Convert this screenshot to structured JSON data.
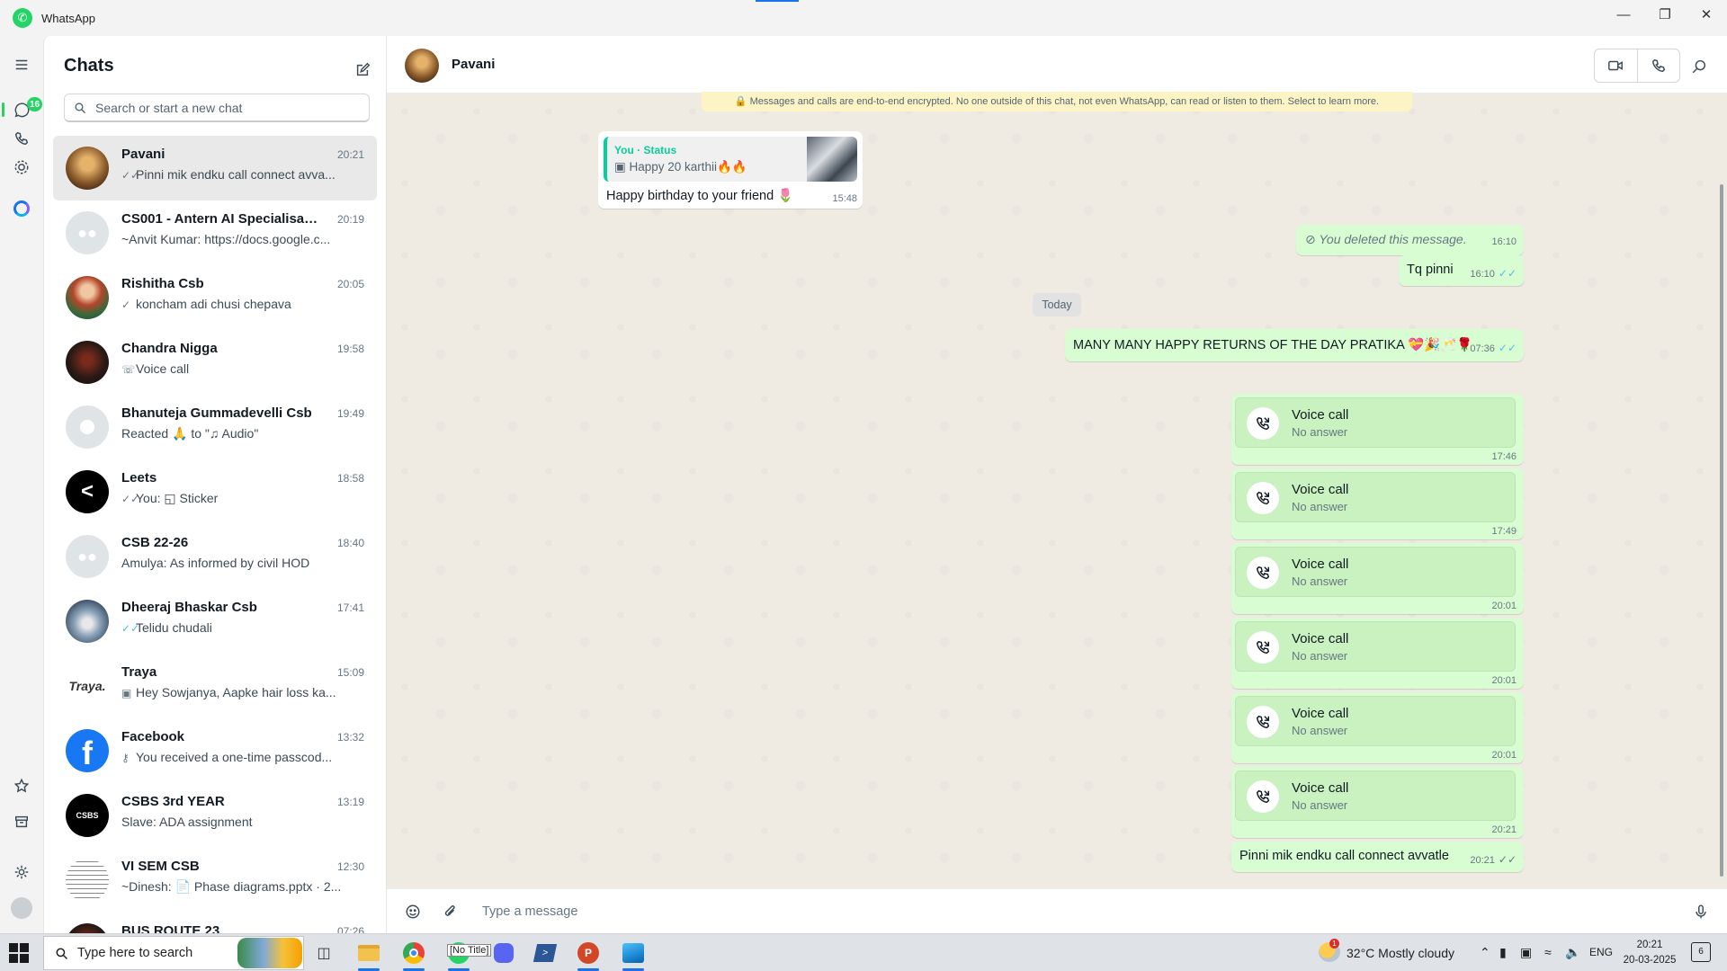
{
  "window": {
    "title": "WhatsApp",
    "controls": [
      "minimize",
      "restore",
      "close"
    ]
  },
  "rail": {
    "unread_badge": "16",
    "icons": [
      "menu-icon",
      "chats-icon",
      "calls-icon",
      "status-icon",
      "meta-ai-icon",
      "starred-icon",
      "archive-icon",
      "settings-icon",
      "profile-icon"
    ]
  },
  "sidebar": {
    "title": "Chats",
    "search_placeholder": "Search or start a new chat",
    "chats": [
      {
        "name": "Pavani",
        "time": "20:21",
        "icon": "✓✓",
        "icon_color": "gray",
        "preview": "Pinni mik endku call connect avva...",
        "avatar": "photo-warm",
        "selected": true
      },
      {
        "name": "CS001 - Antern AI Specialisation",
        "time": "20:19",
        "icon": "",
        "icon_color": "gray",
        "preview": "~Anvit Kumar: https://docs.google.c...",
        "avatar": "group",
        "selected": false
      },
      {
        "name": "Rishitha Csb",
        "time": "20:05",
        "icon": "✓",
        "icon_color": "gray",
        "preview": "koncham adi chusi chepava",
        "avatar": "photo-colorful",
        "selected": false
      },
      {
        "name": "Chandra Nigga",
        "time": "19:58",
        "icon": "☏",
        "icon_color": "gray",
        "preview": "Voice call",
        "avatar": "photo-dark",
        "selected": false
      },
      {
        "name": "Bhanuteja Gummadevelli Csb",
        "time": "19:49",
        "icon": "",
        "icon_color": "gray",
        "preview": "Reacted 🙏 to \"♫ Audio\"",
        "avatar": "person",
        "selected": false
      },
      {
        "name": "Leets",
        "time": "18:58",
        "icon": "✓✓",
        "icon_color": "gray",
        "preview": "You: ◱ Sticker",
        "avatar": "leets",
        "selected": false
      },
      {
        "name": "CSB 22-26",
        "time": "18:40",
        "icon": "",
        "icon_color": "gray",
        "preview": "Amulya: As informed by civil HOD",
        "avatar": "group",
        "selected": false
      },
      {
        "name": "Dheeraj Bhaskar Csb",
        "time": "17:41",
        "icon": "✓✓",
        "icon_color": "blue",
        "preview": "Telidu chudali",
        "avatar": "photo-blue",
        "selected": false
      },
      {
        "name": "Traya",
        "time": "15:09",
        "icon": "▣",
        "icon_color": "gray",
        "preview": "Hey Sowjanya,  Aapke hair loss ka...",
        "avatar": "traya",
        "selected": false
      },
      {
        "name": "Facebook",
        "time": "13:32",
        "icon": "⚷",
        "icon_color": "gray",
        "preview": "You received a one-time passcod...",
        "avatar": "facebook",
        "selected": false
      },
      {
        "name": "CSBS 3rd YEAR",
        "time": "13:19",
        "icon": "",
        "icon_color": "gray",
        "preview": "Slave: ADA assignment",
        "avatar": "csbs",
        "selected": false
      },
      {
        "name": "VI SEM CSB",
        "time": "12:30",
        "icon": "",
        "icon_color": "gray",
        "preview": "~Dinesh: 📄 Phase diagrams.pptx · 2...",
        "avatar": "doc",
        "selected": false
      },
      {
        "name": "BUS ROUTE 23",
        "time": "07:26",
        "icon": "",
        "icon_color": "gray",
        "preview": "",
        "avatar": "photo-dark",
        "selected": false
      }
    ]
  },
  "conversation": {
    "contact_name": "Pavani",
    "encryption_note": "🔒 Messages and calls are end-to-end encrypted. No one outside of this chat, not even WhatsApp, can read or listen to them. Select to learn more.",
    "status_reply": {
      "who": "You · Status",
      "text": "▣ Happy 20 karthii🔥🔥",
      "message": "Happy birthday to your friend 🌷",
      "time": "15:48"
    },
    "deleted": {
      "text": "⊘  You deleted this message.",
      "time": "16:10"
    },
    "tq": {
      "text": "Tq pinni",
      "time": "16:10"
    },
    "date_chip": "Today",
    "birthday": {
      "text": "MANY MANY HAPPY RETURNS OF THE DAY PRATIKA 💝🎉🥂🌹",
      "time": "07:36"
    },
    "calls": [
      {
        "title": "Voice call",
        "subtitle": "No answer",
        "time": "17:46"
      },
      {
        "title": "Voice call",
        "subtitle": "No answer",
        "time": "17:49"
      },
      {
        "title": "Voice call",
        "subtitle": "No answer",
        "time": "20:01"
      },
      {
        "title": "Voice call",
        "subtitle": "No answer",
        "time": "20:01"
      },
      {
        "title": "Voice call",
        "subtitle": "No answer",
        "time": "20:01"
      },
      {
        "title": "Voice call",
        "subtitle": "No answer",
        "time": "20:21"
      }
    ],
    "last": {
      "text": "Pinni mik endku call connect avvatle",
      "time": "20:21"
    },
    "composer_placeholder": "Type a message"
  },
  "taskbar": {
    "search_placeholder": "Type here to search",
    "no_title_label": "[No Title]",
    "weather_badge": "1",
    "weather": "32°C  Mostly cloudy",
    "language": "ENG",
    "time": "20:21",
    "date": "20-03-2025",
    "notifications": "6"
  },
  "colors": {
    "accent": "#25d366",
    "outgoing_bubble": "#d9fdd3",
    "call_card": "#c9f2c0",
    "read_tick": "#53bdeb",
    "wallpaper": "#efeae2"
  }
}
